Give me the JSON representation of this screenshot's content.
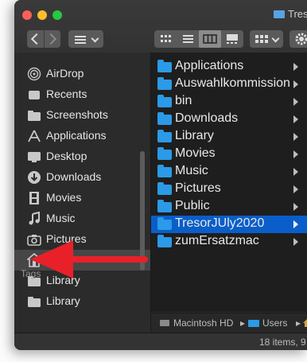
{
  "window": {
    "title": "Tresor"
  },
  "sidebar": {
    "items": [
      {
        "label": "AirDrop",
        "icon": "airdrop-icon"
      },
      {
        "label": "Recents",
        "icon": "clock-icon"
      },
      {
        "label": "Screenshots",
        "icon": "folder-icon"
      },
      {
        "label": "Applications",
        "icon": "applications-icon"
      },
      {
        "label": "Desktop",
        "icon": "desktop-icon"
      },
      {
        "label": "Downloads",
        "icon": "download-icon"
      },
      {
        "label": "Movies",
        "icon": "film-icon"
      },
      {
        "label": "Music",
        "icon": "music-icon"
      },
      {
        "label": "Pictures",
        "icon": "camera-icon"
      },
      {
        "label": "",
        "icon": "home-icon"
      },
      {
        "label": "Library",
        "icon": "folder-icon"
      },
      {
        "label": "Library",
        "icon": "folder-icon"
      }
    ],
    "tags_label": "Tags",
    "selected_index": 9
  },
  "column": {
    "items": [
      "Applications",
      "Auswahlkommission",
      "bin",
      "Downloads",
      "Library",
      "Movies",
      "Music",
      "Pictures",
      "Public",
      "TresorJUly2020",
      "zumErsatzmac"
    ],
    "selected_index": 9
  },
  "pathbar": {
    "drive": "Macintosh HD",
    "sep": "▸",
    "users": "Users",
    "sep2": "▸"
  },
  "status": {
    "text": "18 items, 9"
  },
  "colors": {
    "selection": "#0a5ec9",
    "folder": "#2b9ae8",
    "arrow": "#e8202a"
  }
}
